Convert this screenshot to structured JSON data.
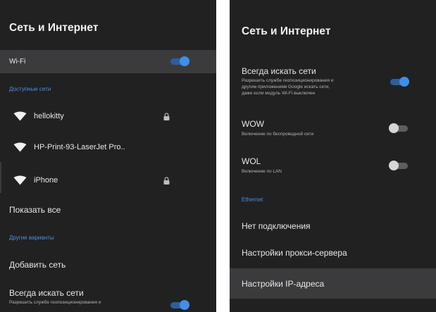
{
  "left": {
    "title": "Сеть и Интернет",
    "wifi": {
      "label": "Wi-Fi",
      "enabled": true
    },
    "available_header": "Доступные сети",
    "networks": [
      {
        "name": "hellokitty",
        "secured": true,
        "icon": "wifi-icon"
      },
      {
        "name": "HP-Print-93-LaserJet Pro..",
        "secured": false,
        "icon": "wifi-icon"
      },
      {
        "name": "iPhone",
        "secured": true,
        "icon": "wifi-icon"
      }
    ],
    "show_all": "Показать все",
    "other_header": "Другие варианты",
    "add_network": "Добавить сеть",
    "always_scan": {
      "title": "Всегда искать сети",
      "subtitle": "Разрешить службе геопозиционирования и",
      "enabled": true
    }
  },
  "right": {
    "title": "Сеть и Интернет",
    "always_scan": {
      "title": "Всегда искать сети",
      "subtitle": "Разрешить службе геопозиционирования и\nдругим приложениям Google искать сети,\nдаже если модуль Wi-Fi выключен",
      "enabled": true
    },
    "wow": {
      "title": "WOW",
      "subtitle": "Включение по беспроводной сети",
      "enabled": false
    },
    "wol": {
      "title": "WOL",
      "subtitle": "Включение по LAN",
      "enabled": false
    },
    "ethernet_header": "Ethernet",
    "no_connection": "Нет подключения",
    "proxy": "Настройки прокси-сервера",
    "ip": "Настройки IP-адреса"
  },
  "colors": {
    "background": "#212121",
    "selected_row": "#3b3b3d",
    "accent": "#3f8fe8",
    "section_header": "#4a90e2"
  }
}
